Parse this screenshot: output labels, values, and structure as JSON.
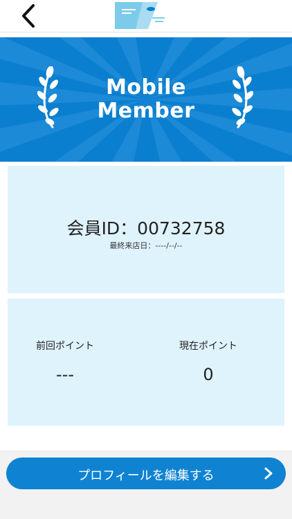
{
  "colors": {
    "accent": "#0f83d2",
    "hero_blue": "#0b7fcf",
    "card_bg": "#dff3fc",
    "text": "#222222"
  },
  "header": {
    "back_icon": "chevron-left-icon",
    "logo_icon": "brand-logo"
  },
  "hero": {
    "title_line1": "Mobile",
    "title_line2": "Member",
    "decoration_icon": "laurel-icon"
  },
  "member": {
    "id_line": "会員ID：00732758",
    "last_visit": "最終来店日：----/--/--"
  },
  "points": {
    "previous_label": "前回ポイント",
    "previous_value": "---",
    "current_label": "現在ポイント",
    "current_value": "0"
  },
  "actions": {
    "edit_profile_label": "プロフィールを編集する",
    "edit_profile_icon": "chevron-right-icon"
  }
}
